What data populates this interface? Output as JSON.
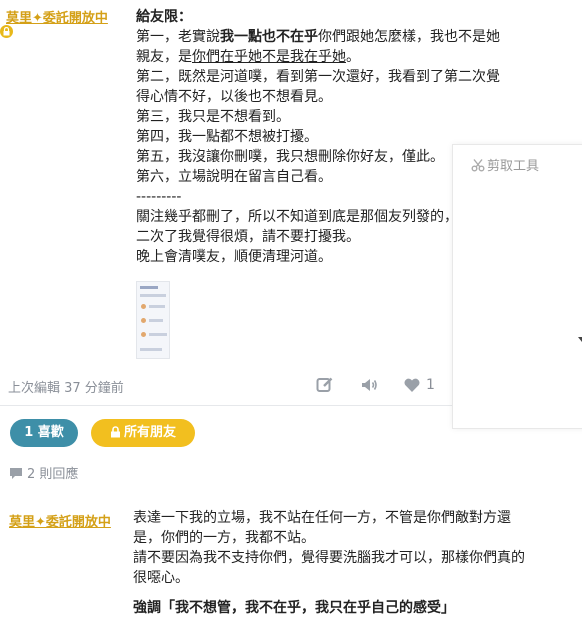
{
  "post": {
    "author": "莫里✦委託開放中",
    "greeting": "給友限：",
    "l1a": "第一，老實說",
    "l1b": "我一點也不在乎",
    "l1c": "你們跟她怎麼樣，我也不是她",
    "l2a": "親友，是",
    "l2b": "你們在乎她不是我在乎她",
    "l2c": "。",
    "l3": "第二，既然是河道噗，看到第一次還好，我看到了第二次覺",
    "l4": "得心情不好，以後也不想看見。",
    "l5": "第三，我只是不想看到。",
    "l6": "第四，我一點都不想被打擾。",
    "l7": "第五，我沒讓你刪噗，我只想刪除你好友，僅此。",
    "l8": "第六，立場說明在留言自己看。",
    "sep": "---------",
    "l9": "關注幾乎都刪了，所以不知道到底是那個友列發的，看到第",
    "l10": "二次了我覺得很煩，請不要打擾我。",
    "l11": "晚上會清噗友，順便清理河道。",
    "edited": "上次編輯 37 分鐘前",
    "like_count": "1"
  },
  "reactions": {
    "likes_label": "1 喜歡",
    "audience_label": "所有朋友"
  },
  "replies_count": "2 則回應",
  "reply": {
    "author": "莫里✦委託開放中",
    "r1": "表達一下我的立場，我不站在任何一方，不管是你們敵對方還",
    "r2": "是，你們的一方，我都不站。",
    "r3": "請不要因為我不支持你們，覺得要洗腦我才可以，那樣你們真的",
    "r4": "很噁心。",
    "r5": "強調「我不想管，我不在乎，我只在乎自己的感受」"
  },
  "clip_tool": {
    "title": "剪取工具"
  },
  "colors": {
    "author": "#d4a017",
    "likes_pill": "#3e8fa8",
    "friends_pill": "#f2bf1f",
    "muted": "#8a8f98"
  },
  "icons": [
    "lock-icon",
    "edit-icon",
    "mute-icon",
    "heart-icon",
    "star-icon",
    "block-icon",
    "chevron-down-icon",
    "comment-icon",
    "scissors-icon"
  ]
}
